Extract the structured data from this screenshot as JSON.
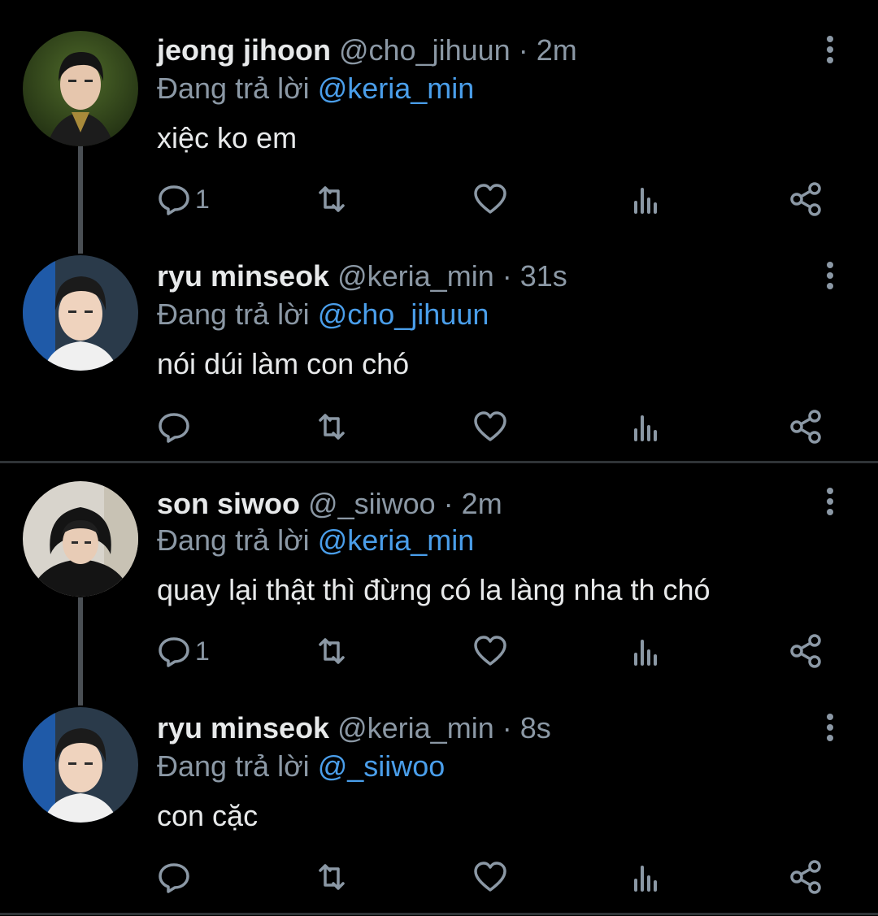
{
  "tweets": [
    {
      "name": "jeong jihoon",
      "handle": "@cho_jihuun",
      "sep": "·",
      "time": "2m",
      "reply_prefix": "Đang trả lời",
      "reply_to": "@keria_min",
      "text": "xiệc ko em",
      "reply_count": "1",
      "avatar": "avatar-photo-green"
    },
    {
      "name": "ryu minseok",
      "handle": "@keria_min",
      "sep": "·",
      "time": "31s",
      "reply_prefix": "Đang trả lời",
      "reply_to": "@cho_jihuun",
      "text": "nói dúi làm con chó",
      "reply_count": "",
      "avatar": "avatar-photo-blue"
    },
    {
      "name": "son siwoo",
      "handle": "@_siiwoo",
      "sep": "·",
      "time": "2m",
      "reply_prefix": "Đang trả lời",
      "reply_to": "@keria_min",
      "text": "quay lại thật thì đừng có la làng nha th chó",
      "reply_count": "1",
      "avatar": "avatar-photo-hood"
    },
    {
      "name": "ryu minseok",
      "handle": "@keria_min",
      "sep": "·",
      "time": "8s",
      "reply_prefix": "Đang trả lời",
      "reply_to": "@_siiwoo",
      "text": "con cặc",
      "reply_count": "",
      "avatar": "avatar-photo-blue"
    }
  ],
  "colors": {
    "background": "#000000",
    "text": "#e7e9ea",
    "secondary": "#8b98a5",
    "mention": "#4a9eea",
    "thread_line": "#4a4f54"
  },
  "icons": [
    "reply-icon",
    "retweet-icon",
    "like-icon",
    "analytics-icon",
    "share-icon",
    "more-icon"
  ]
}
